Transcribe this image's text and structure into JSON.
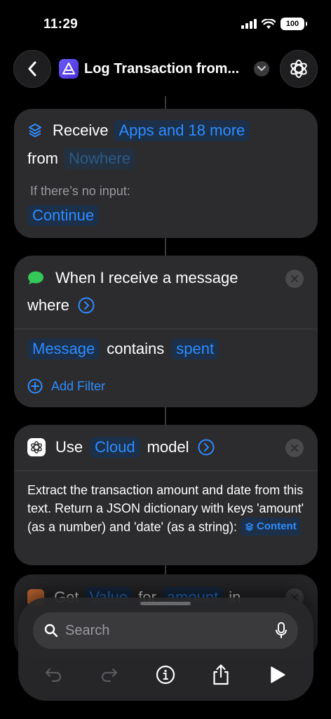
{
  "status": {
    "time": "11:29",
    "battery": "100"
  },
  "nav": {
    "title": "Log Transaction from..."
  },
  "receive_card": {
    "receive_label": "Receive",
    "types_token": "Apps and 18 more",
    "from_label": "from",
    "source_token": "Nowhere",
    "no_input_label": "If there’s no input:",
    "no_input_action": "Continue"
  },
  "message_card": {
    "trigger_text": "When I receive a message",
    "where_label": "where",
    "filter_field": "Message",
    "filter_op": "contains",
    "filter_value": "spent",
    "add_filter_label": "Add Filter"
  },
  "model_card": {
    "use_label": "Use",
    "model_token": "Cloud",
    "model_label": "model",
    "prompt": "Extract the transaction amount and date from this text. Return a JSON dictionary with keys 'amount' (as a number) and 'date' (as a string):",
    "content_token": "Content"
  },
  "get_card": {
    "get_label": "Get",
    "value_token": "Value",
    "for_label": "for",
    "key_token": "amount",
    "in_label": "in"
  },
  "toolbar": {
    "search_placeholder": "Search"
  },
  "colors": {
    "accent": "#2f8cff",
    "card": "#2c2c2e",
    "background": "#000000",
    "messages_green": "#34c759"
  }
}
